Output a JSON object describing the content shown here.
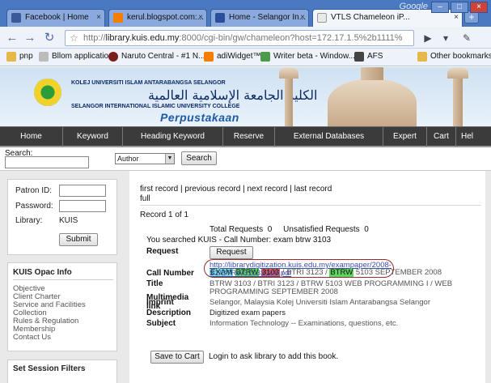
{
  "browser": {
    "tabs": [
      {
        "title": "Facebook | Home",
        "favicon_color": "#3b5998"
      },
      {
        "title": "kerul.blogspot.com:...",
        "favicon_color": "#f57d00"
      },
      {
        "title": "Home - Selangor In...",
        "favicon_color": "#2a4f9a"
      },
      {
        "title": "VTLS Chameleon iP...",
        "favicon_color": "#ffffff"
      }
    ],
    "brand": "Google",
    "url_prefix": "http://",
    "url_host": "library.kuis.edu.my",
    "url_rest": ":8000/cgi-bin/gw/chameleon?host=172.17.1.5%2b1111%",
    "bookmarks": [
      "pnp",
      "Bllom application",
      "Naruto Central - #1 N...",
      "adiWidget™",
      "Writer beta - Window...",
      "AFS",
      "Other bookmarks"
    ]
  },
  "banner": {
    "title": "KOLEJ UNIVERSITI ISLAM ANTARABANGSA SELANGOR",
    "arabic": "الكلية الجامعة الإسلامية العالمية",
    "subtitle": "SELANGOR INTERNATIONAL ISLAMIC UNIVERSITY COLLEGE",
    "section": "Perpustakaan"
  },
  "menu": [
    "Home",
    "Keyword",
    "Heading Keyword",
    "Reserve",
    "External Databases",
    "Expert",
    "Cart",
    "Hel"
  ],
  "search": {
    "label": "Search:",
    "field_value": "",
    "type_selected": "Author",
    "button": "Search"
  },
  "sidebar": {
    "patron_label": "Patron ID:",
    "password_label": "Password:",
    "library_label": "Library:",
    "library_value": "KUIS",
    "submit": "Submit",
    "info_title": "KUIS Opac Info",
    "info_links": [
      "Objective",
      "Client Charter",
      "Service and Facilities",
      "Collection",
      "Rules & Regulation",
      "Membership",
      "Contact Us"
    ],
    "filters_title": "Set Session Filters"
  },
  "record": {
    "nav": "first record | previous record | next record | last record",
    "full": "full",
    "count": "Record 1 of 1",
    "totals": "Total Requests  0     Unsatisfied Requests  0",
    "searched": "You searched KUIS - Call Number: exam btrw 3103",
    "request_label": "Request",
    "request_button": "Request",
    "call_number_label": "Call Number",
    "call_number": {
      "exam": "EXAM",
      "btrw1": "BTRW",
      "num": "3103",
      "mid": " / BTRI 3123 / ",
      "btrw2": "BTRW",
      "tail": " 5103 SEPTEMBER 2008"
    },
    "title_label": "Title",
    "title_value": "BTRW 3103 / BTRI 3123 / BTRW 5103 WEB PROGRAMMING I / WEB PROGRAMMING SEPTEMBER 2008",
    "imprint_label": "Imprint",
    "imprint_value": "Selangor, Malaysia Kolej Universiti Islam Antarabangsa Selangor",
    "description_label": "Description",
    "description_value": "Digitized exam papers",
    "subject_label": "Subject",
    "subject_value": "Information Technology -- Examinations, questions, etc.",
    "multimedia_label": "Multimedia",
    "link_label": "link",
    "link_line1": "http://librarydigitization.kuis.edu.my/exampaper/2008-",
    "link_line2": "S1/BTRW3103S108.pdf",
    "save_button": "Save to Cart",
    "login_note": "Login to ask library to add this book."
  },
  "colors": {
    "accent_blue": "#4a79c2",
    "menu_bar": "#3b3b3b",
    "highlight_exam": "#7fe0e0",
    "highlight_btrw": "#5fd45f",
    "highlight_3103": "#e85a5a",
    "annotation_oval": "#9b2a2a"
  }
}
